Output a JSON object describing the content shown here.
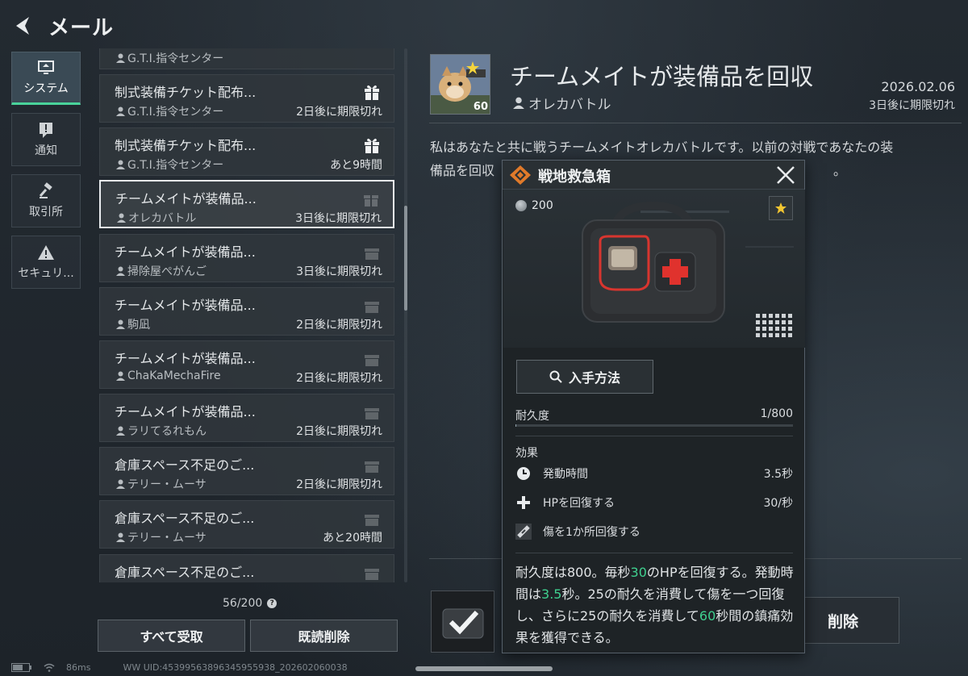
{
  "header": {
    "title": "メール"
  },
  "categories": [
    {
      "label": "システム",
      "icon": "monitor-icon"
    },
    {
      "label": "通知",
      "icon": "alert-icon"
    },
    {
      "label": "取引所",
      "icon": "gavel-icon"
    },
    {
      "label": "セキュリ...",
      "icon": "warning-icon"
    }
  ],
  "mail_list": {
    "partial_top_sender": "G.T.I.指令センター",
    "items": [
      {
        "subject": "制式装備チケット配布...",
        "sender": "G.T.I.指令センター",
        "expiry": "2日後に期限切れ",
        "gift": "active"
      },
      {
        "subject": "制式装備チケット配布...",
        "sender": "G.T.I.指令センター",
        "expiry": "あと9時間",
        "gift": "active"
      },
      {
        "subject": "チームメイトが装備品...",
        "sender": "オレカバトル",
        "expiry": "3日後に期限切れ",
        "gift": "faded"
      },
      {
        "subject": "チームメイトが装備品...",
        "sender": "掃除屋ぺがんご",
        "expiry": "3日後に期限切れ",
        "gift": "faded"
      },
      {
        "subject": "チームメイトが装備品...",
        "sender": "駒凪",
        "expiry": "2日後に期限切れ",
        "gift": "faded"
      },
      {
        "subject": "チームメイトが装備品...",
        "sender": "ChaKaMechaFire",
        "expiry": "2日後に期限切れ",
        "gift": "faded"
      },
      {
        "subject": "チームメイトが装備品...",
        "sender": "ラリてるれもん",
        "expiry": "2日後に期限切れ",
        "gift": "faded"
      },
      {
        "subject": "倉庫スペース不足のご...",
        "sender": "テリー・ムーサ",
        "expiry": "2日後に期限切れ",
        "gift": "faded"
      },
      {
        "subject": "倉庫スペース不足のご...",
        "sender": "テリー・ムーサ",
        "expiry": "あと20時間",
        "gift": "faded"
      },
      {
        "subject": "倉庫スペース不足のご...",
        "sender": "",
        "expiry": "",
        "gift": "faded"
      }
    ],
    "count": "56/200",
    "help": "?",
    "claim_all": "すべて受取",
    "delete_read": "既読削除"
  },
  "detail": {
    "title": "チームメイトが装備品を回収",
    "sender": "オレカバトル",
    "date": "2026.02.06",
    "expiry": "3日後に期限切れ",
    "avatar_level": "60",
    "body_line1": "私はあなたと共に戦うチームメイトオレカバトルです。以前の対戦であなたの装",
    "body_line2_start": "備品を回収",
    "body_line2_end": "。",
    "delete": "削除"
  },
  "popup": {
    "title": "戦地救急箱",
    "price": "200",
    "how_to_get": "入手方法",
    "durability_label": "耐久度",
    "durability_value": "1/800",
    "durability_fraction": 0.00125,
    "effects_header": "効果",
    "effects": [
      {
        "icon": "clock-icon",
        "label": "発動時間",
        "value": "3.5秒"
      },
      {
        "icon": "plus-icon",
        "label": "HPを回復する",
        "value": "30/秒"
      },
      {
        "icon": "bandage-icon",
        "label": "傷を1か所回復する",
        "value": ""
      }
    ],
    "desc": {
      "p1": "耐久度は800。毎秒",
      "n1": "30",
      "p2": "のHPを回復する。発動時間は",
      "n2": "3.5",
      "p3": "秒。25の耐久を消費して傷を一つ回復し、さらに25の耐久を消費して",
      "n3": "60",
      "p4": "秒間の鎮痛効果を獲得できる。"
    }
  },
  "footer": {
    "ping": "86ms",
    "uid": "WW UID:45399563896345955938_202602060038"
  },
  "colors": {
    "accent_green": "#49d39b",
    "highlight_number": "#3fd08f",
    "popup_brand_orange": "#e07a2a"
  }
}
